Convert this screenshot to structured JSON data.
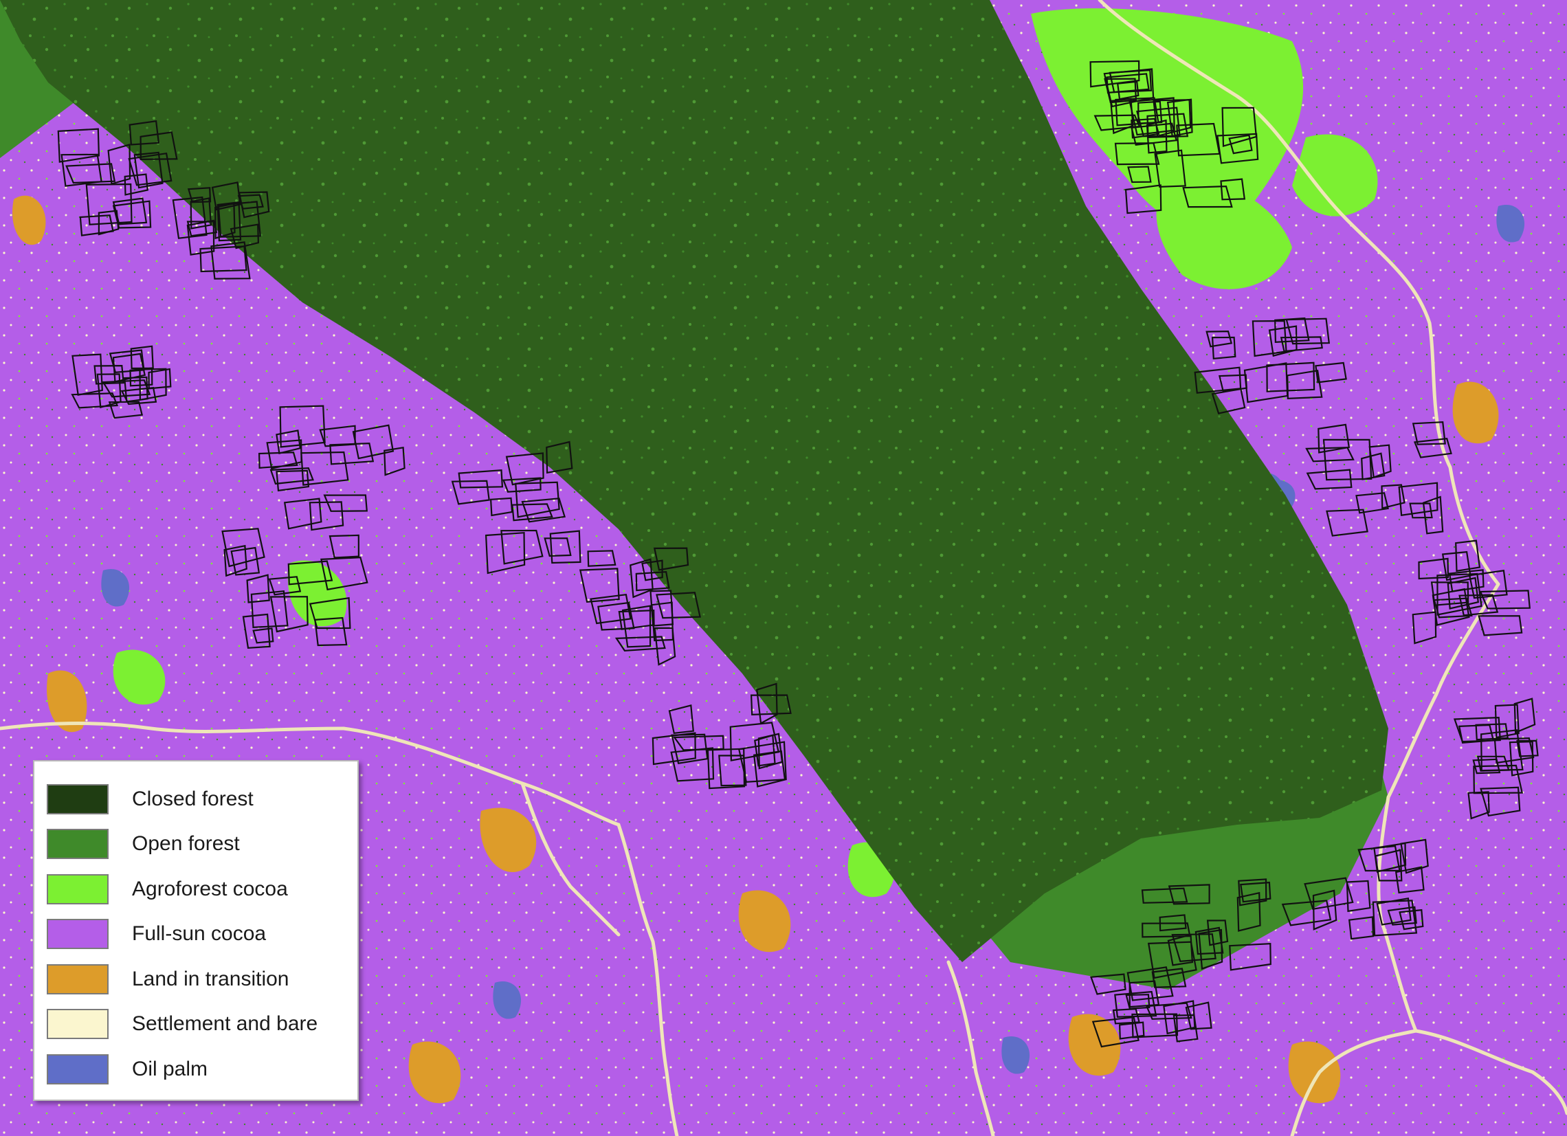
{
  "legend": {
    "items": [
      {
        "label": "Closed forest",
        "color": "#1f3d12"
      },
      {
        "label": "Open forest",
        "color": "#3f8a2a"
      },
      {
        "label": "Agroforest cocoa",
        "color": "#7cf032"
      },
      {
        "label": "Full-sun cocoa",
        "color": "#b45ee8"
      },
      {
        "label": "Land in transition",
        "color": "#dd9c2a"
      },
      {
        "label": "Settlement and bare",
        "color": "#fbf6cf"
      },
      {
        "label": "Oil palm",
        "color": "#5f6ec8"
      }
    ]
  },
  "map_colors": {
    "reserve_forest": "#2f5f1c",
    "parcel_outline": "#111111",
    "road": "#efe6b8"
  }
}
